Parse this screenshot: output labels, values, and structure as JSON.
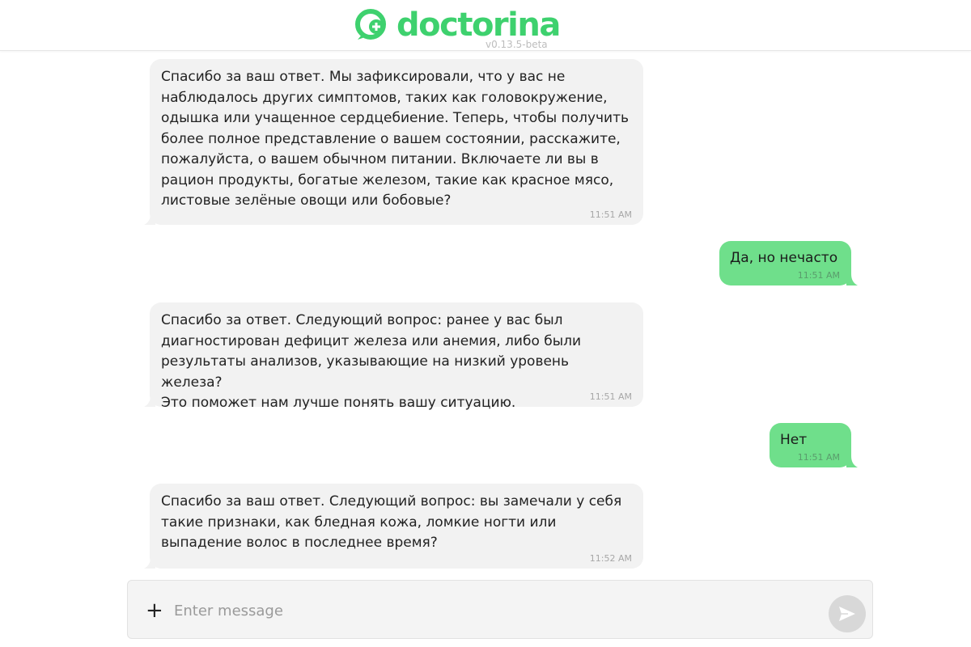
{
  "app": {
    "logo_text": "doctorina",
    "version": "v0.13.5-beta"
  },
  "messages": [
    {
      "role": "bot",
      "text": "Спасибо за ваш ответ. Мы зафиксировали, что у вас не\nнаблюдалось других симптомов, таких как головокружение,\nодышка или учащенное сердцебиение. Теперь, чтобы получить\nболее полное представление о вашем состоянии, расскажите,\nпожалуйста, о вашем обычном питании. Включаете ли вы в\nрацион продукты, богатые железом, такие как красное мясо,\nлистовые зелёные овощи или бобовые?",
      "time": "11:51 AM"
    },
    {
      "role": "user",
      "text": "Да, но нечасто",
      "time": "11:51 AM"
    },
    {
      "role": "bot",
      "text": "Спасибо за ответ. Следующий вопрос: ранее у вас был\nдиагностирован дефицит железа или анемия, либо были\nрезультаты анализов, указывающие на низкий уровень железа?\nЭто поможет нам лучше понять вашу ситуацию.",
      "time": "11:51 AM"
    },
    {
      "role": "user",
      "text": "Нет",
      "time": "11:51 AM"
    },
    {
      "role": "bot",
      "text": "Спасибо за ваш ответ. Следующий вопрос: вы замечали у себя\nтакие признаки, как бледная кожа, ломкие ногти или\nвыпадение волос в последнее время?",
      "time": "11:52 AM"
    }
  ],
  "composer": {
    "attach_icon": "plus-icon",
    "placeholder": "Enter message",
    "value": "",
    "send_icon": "send-icon"
  },
  "colors": {
    "brand": "#3ed16e",
    "user_bubble": "#6fdf8b",
    "bot_bubble": "#f2f2f2"
  }
}
